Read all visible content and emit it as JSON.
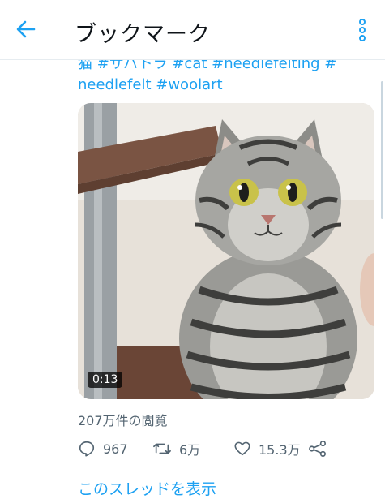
{
  "header": {
    "title": "ブックマーク"
  },
  "icons": {
    "back": "arrow-left-icon",
    "more": "vertical-dots-icon",
    "reply": "speech-bubble-icon",
    "retweet": "retweet-arrows-icon",
    "like": "heart-icon",
    "share": "share-nodes-icon"
  },
  "tweet": {
    "text_line1": "猫 #サバトラ #cat #needlefelting #",
    "text_line2": "needlefelt #woolart",
    "video_duration": "0:13",
    "views": "207万件の閲覧",
    "replies": "967",
    "retweets": "6万",
    "likes": "15.3万",
    "show_thread": "このスレッドを表示"
  },
  "colors": {
    "accent": "#1da1f2",
    "secondary_text": "#536471",
    "primary_text": "#0f1419"
  }
}
